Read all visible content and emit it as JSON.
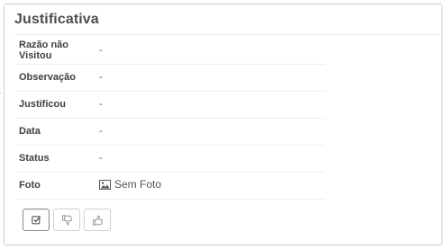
{
  "panel": {
    "title": "Justificativa"
  },
  "details": {
    "rows": [
      {
        "label": "Razão não Visitou",
        "value": "-"
      },
      {
        "label": "Observação",
        "value": "-"
      },
      {
        "label": "Justificou",
        "value": "-"
      },
      {
        "label": "Data",
        "value": "-"
      },
      {
        "label": "Status",
        "value": "-"
      }
    ],
    "photo": {
      "label": "Foto",
      "value": "Sem Foto",
      "icon": "image-icon"
    }
  },
  "actions": {
    "buttons": [
      {
        "icon": "check-square-icon",
        "state": "active"
      },
      {
        "icon": "thumbs-down-icon",
        "state": "normal"
      },
      {
        "icon": "thumbs-up-icon",
        "state": "normal"
      }
    ]
  },
  "colors": {
    "border": "#cfcfcf",
    "title": "#4d4d4d",
    "label": "#404040",
    "icon": "#666666"
  }
}
